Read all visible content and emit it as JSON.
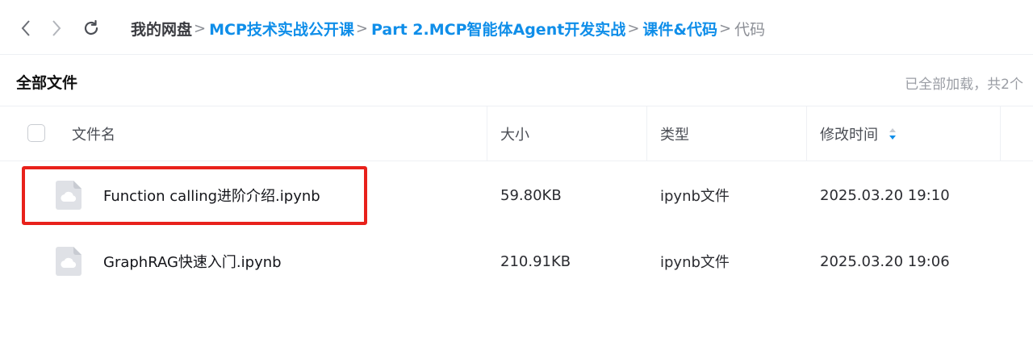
{
  "nav": {
    "back": "chevron-left-icon",
    "forward": "chevron-right-icon",
    "refresh": "refresh-icon"
  },
  "breadcrumb": {
    "root": "我的网盘",
    "sep": ">",
    "links": [
      "MCP技术实战公开课",
      "Part 2.MCP智能体Agent开发实战",
      "课件&代码"
    ],
    "current": "代码"
  },
  "subbar": {
    "title": "全部文件",
    "status": "已全部加载，共2个"
  },
  "table": {
    "columns": {
      "name": "文件名",
      "size": "大小",
      "type": "类型",
      "mtime": "修改时间"
    },
    "sort_icon": "sort-icon",
    "rows": [
      {
        "name": "Function calling进阶介绍.ipynb",
        "size": "59.80KB",
        "type": "ipynb文件",
        "mtime": "2025.03.20 19:10",
        "icon": "cloud-file-icon"
      },
      {
        "name": "GraphRAG快速入门.ipynb",
        "size": "210.91KB",
        "type": "ipynb文件",
        "mtime": "2025.03.20 19:06",
        "icon": "cloud-file-icon"
      }
    ]
  },
  "colors": {
    "accent": "#0f8ee9",
    "highlight": "#e8211b",
    "divider": "#eef0f4"
  }
}
